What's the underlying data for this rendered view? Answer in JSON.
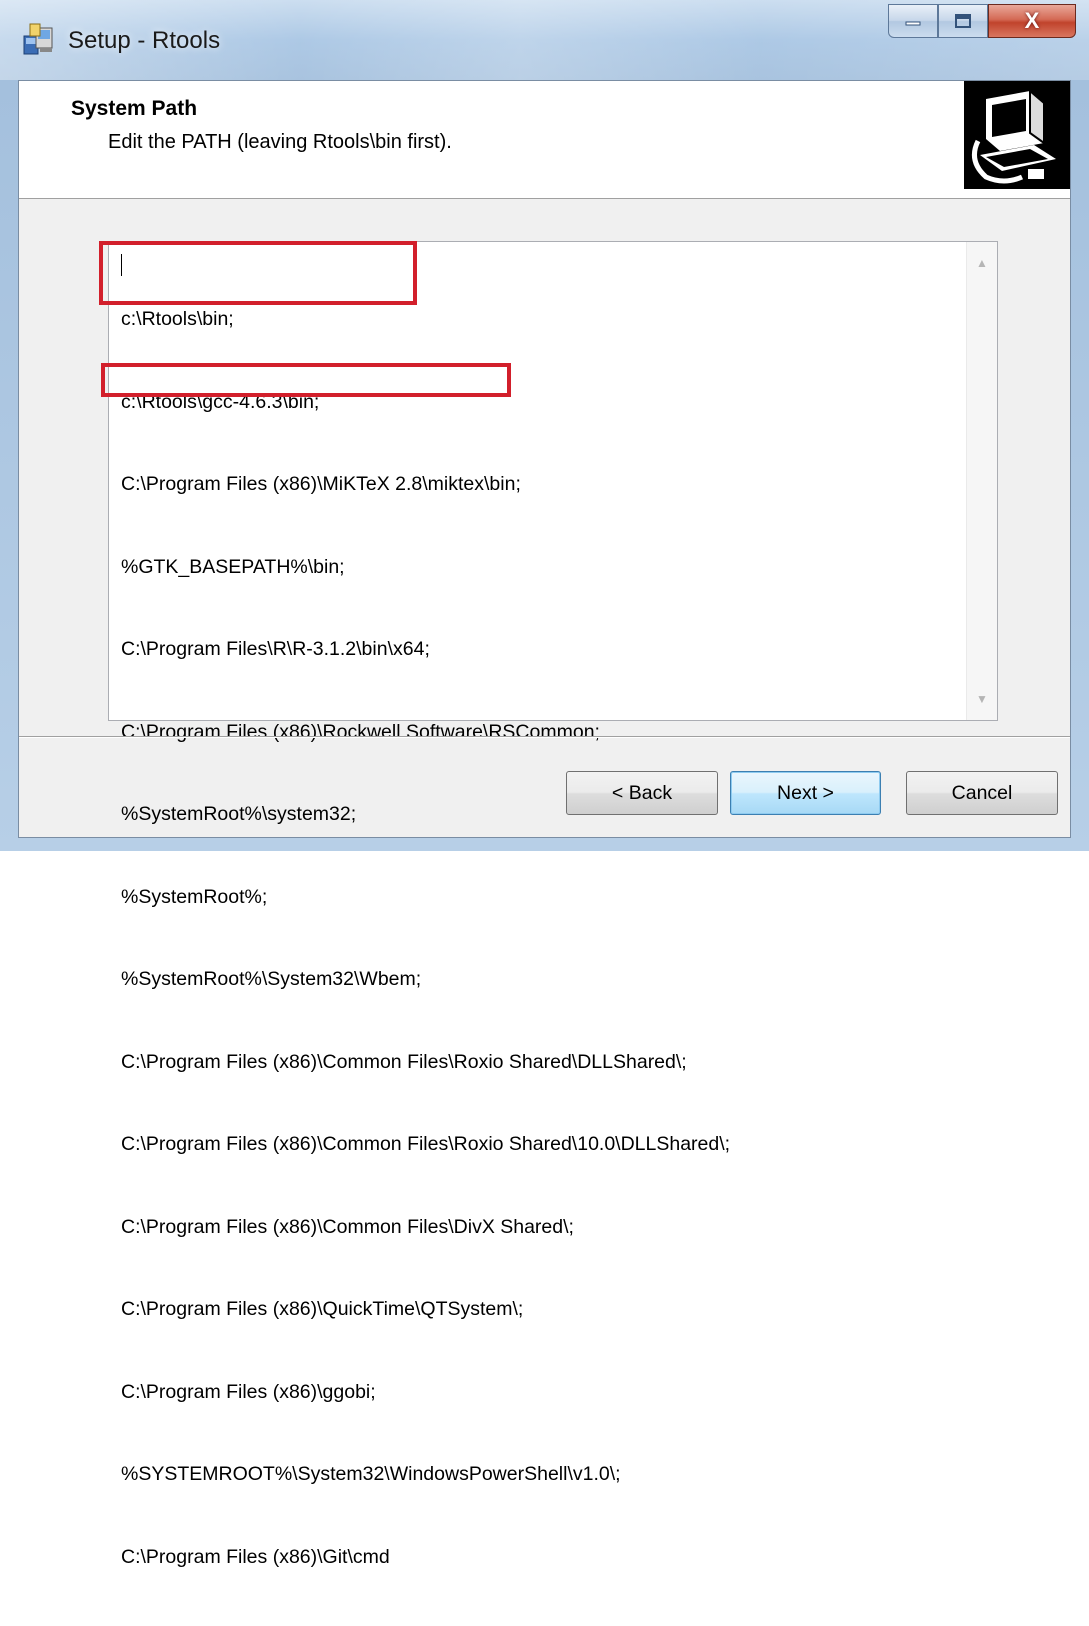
{
  "window": {
    "title": "Setup - Rtools",
    "icons": {
      "app": "setup-installer-icon",
      "minimize": "minimize-icon",
      "maximize": "maximize-icon",
      "close": "close-icon"
    },
    "close_glyph": "X"
  },
  "header": {
    "title": "System Path",
    "subtitle": "Edit the PATH (leaving Rtools\\bin first).",
    "image": "computer-install-icon"
  },
  "path_editor": {
    "lines": [
      "c:\\Rtools\\bin;",
      "c:\\Rtools\\gcc-4.6.3\\bin;",
      "C:\\Program Files (x86)\\MiKTeX 2.8\\miktex\\bin;",
      "%GTK_BASEPATH%\\bin;",
      "C:\\Program Files\\R\\R-3.1.2\\bin\\x64;",
      "C:\\Program Files (x86)\\Rockwell Software\\RSCommon;",
      "%SystemRoot%\\system32;",
      "%SystemRoot%;",
      "%SystemRoot%\\System32\\Wbem;",
      "C:\\Program Files (x86)\\Common Files\\Roxio Shared\\DLLShared\\;",
      "C:\\Program Files (x86)\\Common Files\\Roxio Shared\\10.0\\DLLShared\\;",
      "C:\\Program Files (x86)\\Common Files\\DivX Shared\\;",
      "C:\\Program Files (x86)\\QuickTime\\QTSystem\\;",
      "C:\\Program Files (x86)\\ggobi;",
      "%SYSTEMROOT%\\System32\\WindowsPowerShell\\v1.0\\;",
      "C:\\Program Files (x86)\\Git\\cmd"
    ],
    "highlight_color": "#d21f2b"
  },
  "buttons": {
    "back": "< Back",
    "next": "Next >",
    "cancel": "Cancel"
  }
}
